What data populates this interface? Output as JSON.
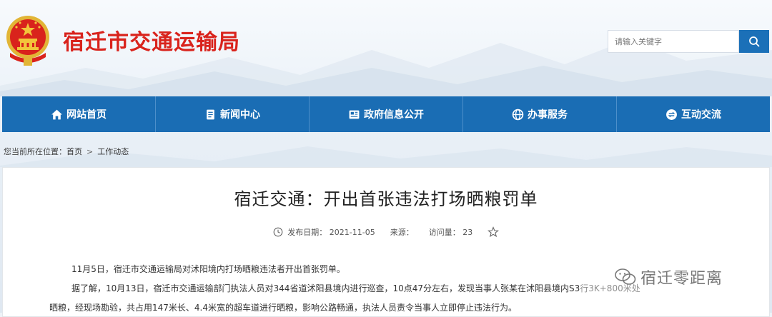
{
  "header": {
    "site_title": "宿迁市交通运输局",
    "search_placeholder": "请输入关键字"
  },
  "nav": [
    {
      "label": "网站首页",
      "icon": "home-icon"
    },
    {
      "label": "新闻中心",
      "icon": "document-icon"
    },
    {
      "label": "政府信息公开",
      "icon": "newspaper-icon"
    },
    {
      "label": "办事服务",
      "icon": "globe-icon"
    },
    {
      "label": "互动交流",
      "icon": "exchange-icon"
    }
  ],
  "breadcrumb": {
    "prefix": "您当前所在位置：",
    "home": "首页",
    "separator": ">",
    "current": "工作动态"
  },
  "article": {
    "title": "宿迁交通：开出首张违法打场晒粮罚单",
    "publish_label": "发布日期：",
    "publish_date": "2021-11-05",
    "source_label": "来源：",
    "views_label": "访问量：",
    "views": "23",
    "paragraphs": [
      "11月5日，宿迁市交通运输局对沭阳境内打场晒粮违法者开出首张罚单。",
      "据了解，10月13日，宿迁市交通运输部门执法人员对344省道沭阳县境内进行巡查，10点47分左右，发现当事人张某在沭阳县境内S3",
      "晒粮，经现场勘验，共占用147米长、4.4米宽的超车道进行晒粮，影响公路畅通，执法人员责令当事人立即停止违法行为。"
    ],
    "para2_obscured_tail": "行3K+800米处"
  },
  "watermark": "宿迁零距离",
  "colors": {
    "brand_red": "#d9231c",
    "nav_blue": "#1a6db4",
    "search_blue": "#1b70b8"
  }
}
